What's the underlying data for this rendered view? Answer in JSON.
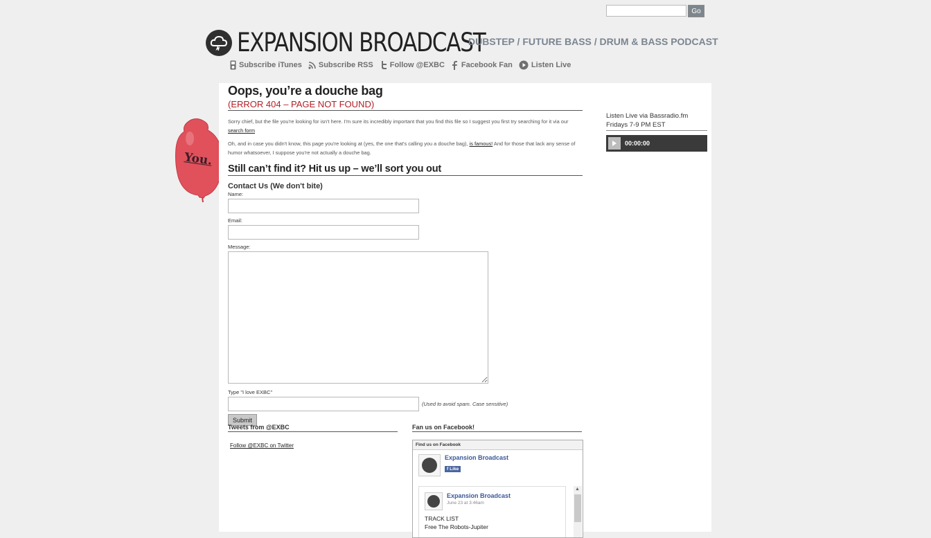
{
  "search": {
    "placeholder": "",
    "button_label": "Go"
  },
  "header": {
    "logo_text": "EXPANSION BROADCAST",
    "tagline": "DUBSTEP / FUTURE BASS / DRUM & BASS PODCAST",
    "nav": [
      {
        "label": "Subscribe iTunes",
        "icon": "ipod-icon"
      },
      {
        "label": "Subscribe RSS",
        "icon": "rss-icon"
      },
      {
        "label": "Follow @EXBC",
        "icon": "twitter-icon"
      },
      {
        "label": "Facebook Fan",
        "icon": "facebook-icon"
      },
      {
        "label": "Listen Live",
        "icon": "play-circle-icon"
      }
    ]
  },
  "main": {
    "title": "Oops, you’re a douche bag",
    "error": "(ERROR 404 – PAGE NOT FOUND)",
    "p1_text": "Sorry chief, but the file you're looking for isn't here. I'm sure its incredibly important that you find this file so I suggest you first try searching for it via our",
    "p1_link": "search form",
    "p2_text": "Oh, and in case you didn't know, this page you're looking at (yes, the one that's calling you a douche bag),",
    "p2_link": "is famous!",
    "p2_text2": "And for those that lack any sense of humor whatsoever, I suppose you're not actually a douche bag.",
    "contact_heading": "Still can’t find it? Hit us up – we’ll sort you out",
    "form_title": "Contact Us (We don't bite)",
    "label_name": "Name:",
    "label_email": "Email:",
    "label_message": "Message:",
    "label_spam": "Type \"I love EXBC\"",
    "spam_note": "(Used to avoid spam. Case sensitive)",
    "submit_label": "Submit",
    "balloon_text": "You."
  },
  "tweets": {
    "heading": "Tweets from @EXBC",
    "link": "Follow @EXBC on Twitter"
  },
  "facebook": {
    "heading": "Fan us on Facebook!",
    "box_title": "Find us on Facebook",
    "page_name": "Expansion Broadcast",
    "like_label": "Like",
    "post_name": "Expansion Broadcast",
    "post_date": "June 23 at 3:46am",
    "post_line1": "TRACK LIST",
    "post_line2": "Free The Robots-Jupiter"
  },
  "sidebar": {
    "listen_line1": "Listen Live via Bassradio.fm",
    "listen_line2": "Fridays 7-9 PM EST",
    "time": "00:00:00"
  },
  "colors": {
    "accent_error": "#b21e24",
    "tagline": "#7a8590",
    "balloon": "#e0515b",
    "facebook_link": "#3b5998"
  }
}
